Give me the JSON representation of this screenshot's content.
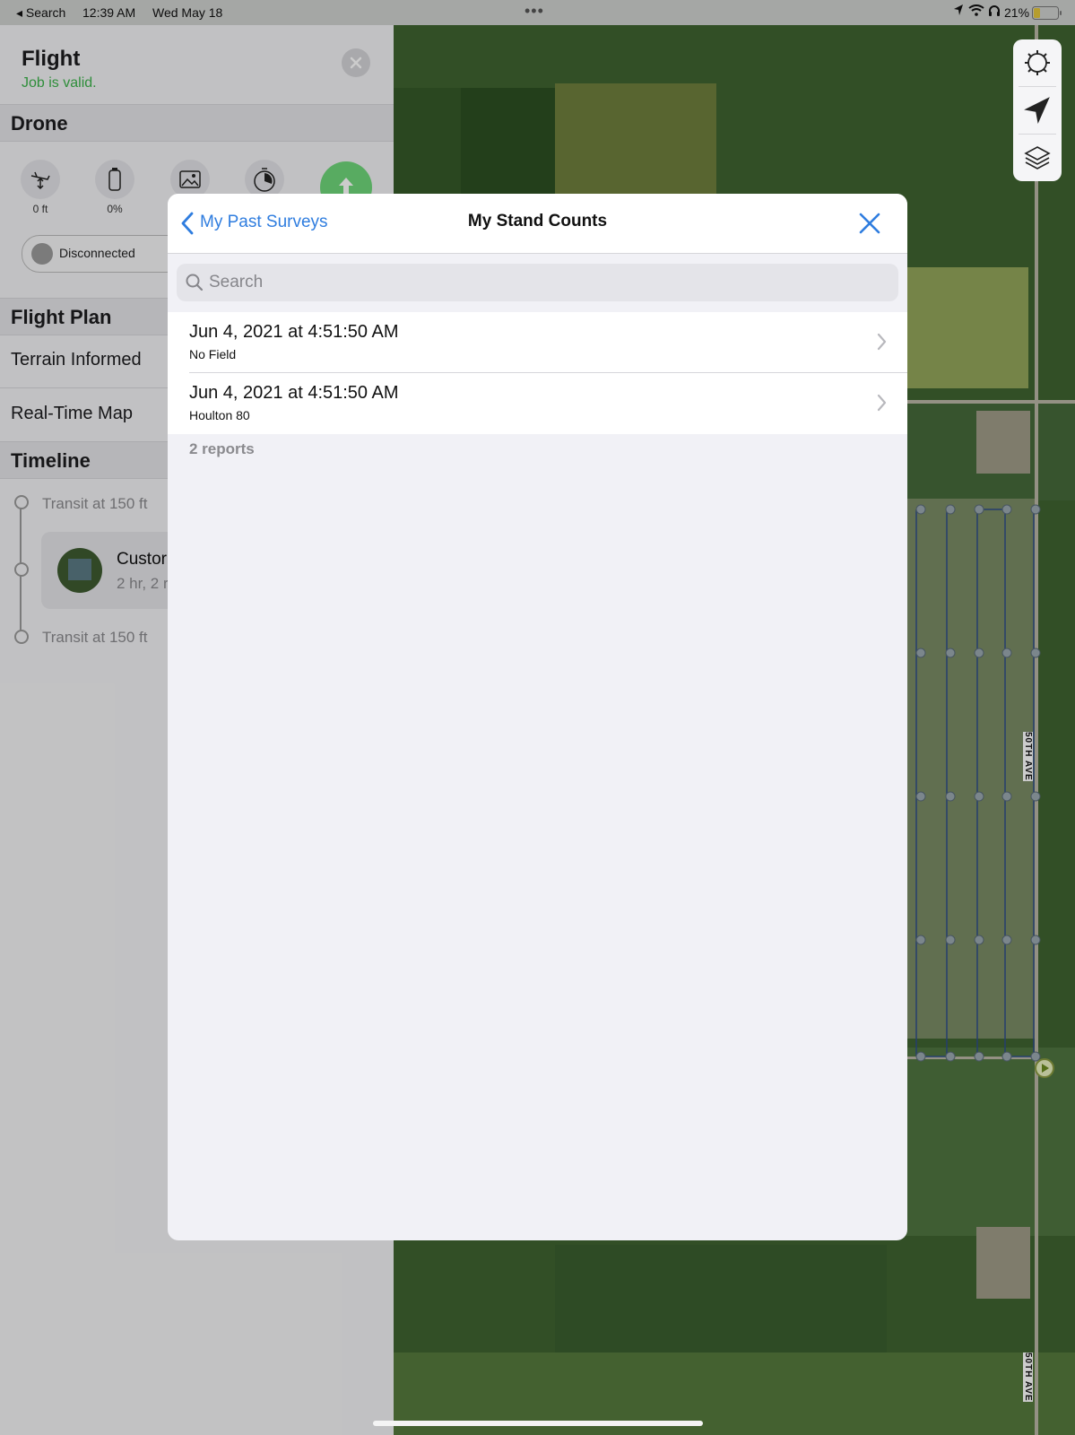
{
  "status": {
    "back_app": "◂ Search",
    "time": "12:39 AM",
    "date": "Wed May 18",
    "battery": "21%"
  },
  "sidebar": {
    "title": "Flight",
    "subtitle": "Job is valid.",
    "drone_header": "Drone",
    "altitude": "0 ft",
    "battery_pct": "0%",
    "connection": "Disconnected",
    "flight_plan_header": "Flight Plan",
    "terrain_label": "Terrain Informed",
    "realtime_label": "Real-Time Map",
    "timeline_header": "Timeline",
    "transit_1": "Transit at 150 ft",
    "mission_title": "Custor",
    "mission_sub": "2 hr, 2 r",
    "transit_2": "Transit at 150 ft"
  },
  "map": {
    "road_label_1": "50TH AVE",
    "road_label_2": "50TH AVE"
  },
  "modal": {
    "back_label": "My Past Surveys",
    "title": "My Stand Counts",
    "search_placeholder": "Search",
    "reports": [
      {
        "title": "Jun 4, 2021 at 4:51:50 AM",
        "subtitle": "No Field"
      },
      {
        "title": "Jun 4, 2021 at 4:51:50 AM",
        "subtitle": "Houlton 80"
      }
    ],
    "count_label": "2 reports"
  },
  "colors": {
    "accent": "#2f7ddf",
    "valid_green": "#3bb24a"
  },
  "icons": [
    "settings-icon",
    "location-arrow-icon",
    "layers-icon",
    "close-icon",
    "chevron-left-icon",
    "chevron-right-icon",
    "search-icon"
  ]
}
